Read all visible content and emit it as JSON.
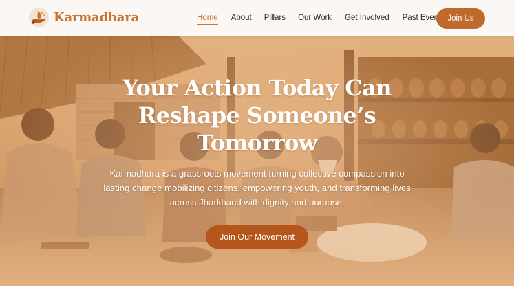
{
  "brand": {
    "name": "Karmadhara",
    "logo_icon": "hand-holding-flame-icon"
  },
  "nav": {
    "items": [
      {
        "label": "Home",
        "active": true
      },
      {
        "label": "About",
        "active": false
      },
      {
        "label": "Pillars",
        "active": false
      },
      {
        "label": "Our Work",
        "active": false
      },
      {
        "label": "Get Involved",
        "active": false
      },
      {
        "label": "Past Events",
        "active": false
      }
    ],
    "cta_label": "Join Us"
  },
  "hero": {
    "title": "Your Action Today Can Reshape Someone’s Tomorrow",
    "description": "Karmadhara is a grassroots movement turning collective compassion into lasting change mobilizing citizens, empowering youth, and transforming lives across Jharkhand with dignity and purpose.",
    "cta_label": "Join Our Movement"
  },
  "colors": {
    "brand": "#c8742f",
    "primary_button": "#bf6a2c",
    "hero_button": "#b5561b",
    "header_bg": "#fbf7f4"
  }
}
